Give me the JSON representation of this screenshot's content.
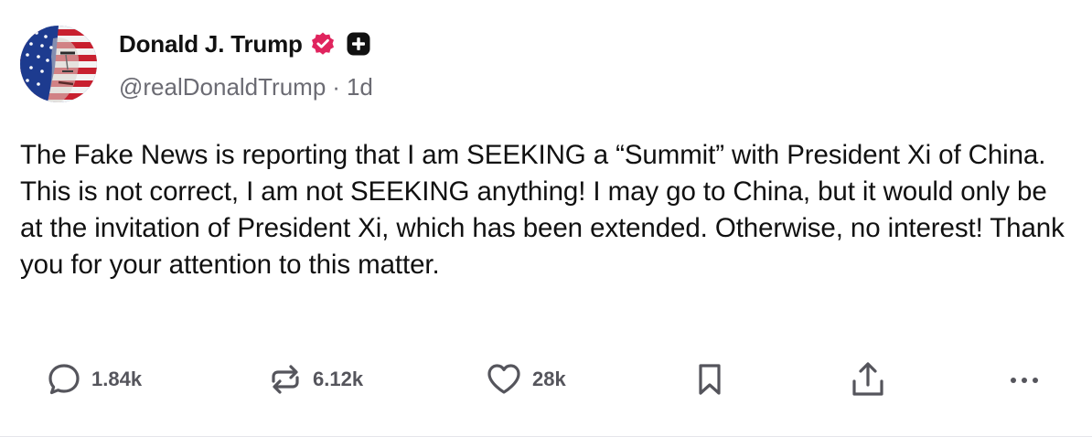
{
  "author": {
    "display_name": "Donald J. Trump",
    "handle": "@realDonaldTrump",
    "separator": "·",
    "timestamp": "1d",
    "avatar_icon": "avatar-flag-portrait",
    "verified_icon": "verified-badge-icon",
    "verified_color": "#e0245e",
    "plus_icon": "plus-badge-icon"
  },
  "post": {
    "text": "The Fake News is reporting that I am SEEKING a “Summit” with President Xi of China. This is not correct, I am not SEEKING anything! I may go to China, but it would only be at the invitation of President Xi, which has been extended. Otherwise, no interest! Thank you for your attention to this matter."
  },
  "actions": {
    "reply": {
      "icon": "reply-icon",
      "count": "1.84k"
    },
    "retruth": {
      "icon": "retruth-icon",
      "count": "6.12k"
    },
    "like": {
      "icon": "heart-icon",
      "count": "28k"
    },
    "bookmark": {
      "icon": "bookmark-icon"
    },
    "share": {
      "icon": "share-icon"
    },
    "more": {
      "icon": "more-icon"
    }
  },
  "colors": {
    "text": "#111111",
    "muted": "#6b6b73",
    "icon": "#55555c",
    "divider": "#e5e5ea"
  }
}
